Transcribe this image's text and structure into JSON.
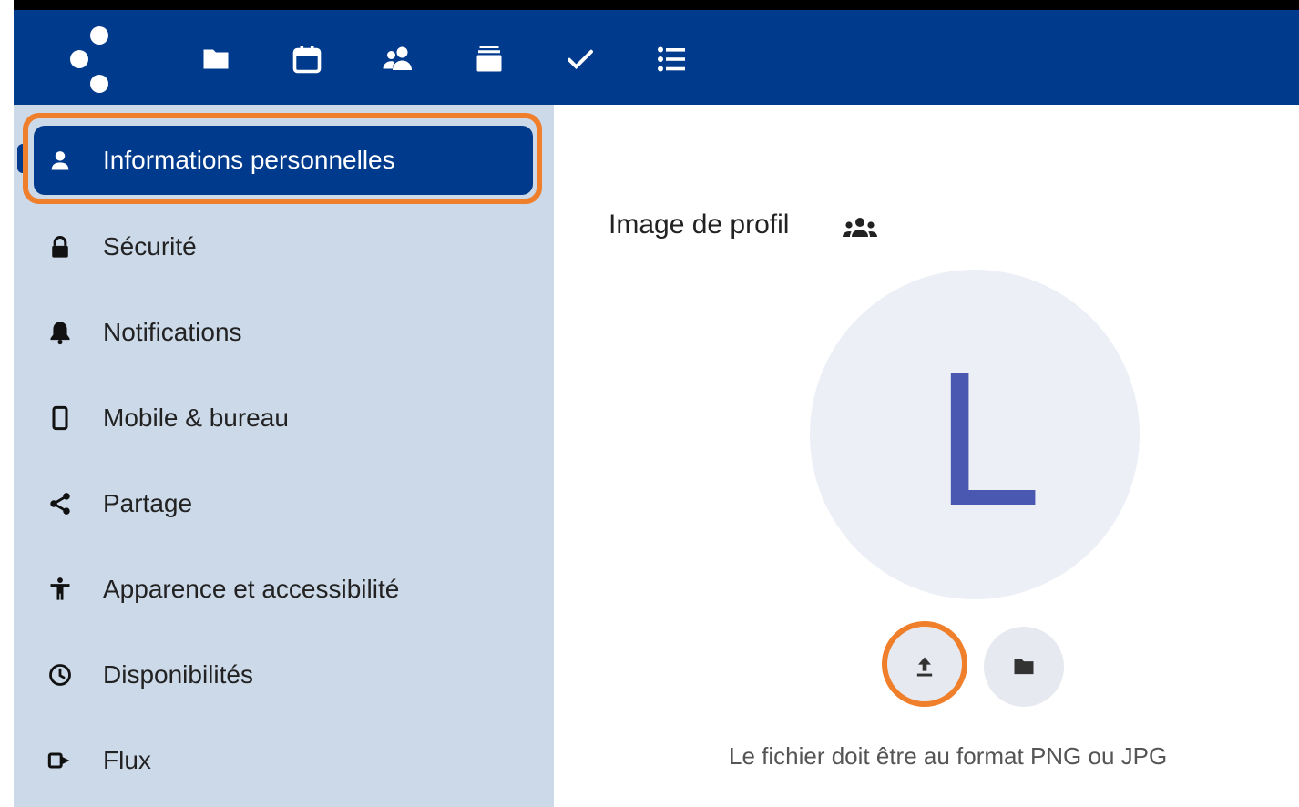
{
  "header": {
    "brand_color": "#003a8c",
    "apps": [
      {
        "name": "files",
        "icon": "folder-icon"
      },
      {
        "name": "calendar",
        "icon": "calendar-icon"
      },
      {
        "name": "contacts",
        "icon": "contacts-icon"
      },
      {
        "name": "deck",
        "icon": "stack-icon"
      },
      {
        "name": "tasks",
        "icon": "checkmark-icon"
      },
      {
        "name": "lists",
        "icon": "list-icon"
      }
    ]
  },
  "sidebar": {
    "items": [
      {
        "label": "Informations personnelles",
        "icon": "user-icon",
        "active": true
      },
      {
        "label": "Sécurité",
        "icon": "lock-icon"
      },
      {
        "label": "Notifications",
        "icon": "bell-icon"
      },
      {
        "label": "Mobile & bureau",
        "icon": "phone-icon"
      },
      {
        "label": "Partage",
        "icon": "share-icon"
      },
      {
        "label": "Apparence et accessibilité",
        "icon": "accessibility-icon"
      },
      {
        "label": "Disponibilités",
        "icon": "clock-icon"
      },
      {
        "label": "Flux",
        "icon": "activity-icon"
      }
    ]
  },
  "main": {
    "section_title": "Image de profil",
    "visibility_icon": "group-icon",
    "avatar_letter": "L",
    "avatar_color": "#4a58b2",
    "upload_icon": "upload-icon",
    "pick_file_icon": "folder-icon",
    "hint": "Le fichier doit être au format PNG ou JPG"
  },
  "highlight_color": "#f07f2c"
}
